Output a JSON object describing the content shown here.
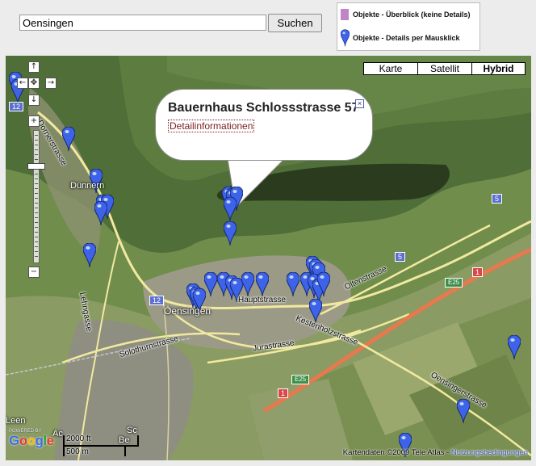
{
  "search": {
    "value": "Oensingen",
    "button_label": "Suchen"
  },
  "legend": {
    "overview_label": "Objekte - Überblick (keine Details)",
    "details_label": "Objekte - Details per Mausklick",
    "overview_color": "#c084c7",
    "details_color": "#3d63e8"
  },
  "map_controls": {
    "pan_up": "↑",
    "pan_left": "←",
    "pan_center": "✥",
    "pan_right": "→",
    "pan_down": "↓",
    "zoom_in": "+",
    "zoom_out": "−"
  },
  "map_types": [
    {
      "label": "Karte",
      "active": false
    },
    {
      "label": "Satellit",
      "active": false
    },
    {
      "label": "Hybrid",
      "active": true
    }
  ],
  "info_window": {
    "title": "Bauernhaus Schlossstrasse 57",
    "link": "Detailinformationen",
    "close": "×"
  },
  "street_labels": [
    "Hauptstrasse",
    "Kestenholzstrasse",
    "Jurastrasse",
    "Solothurnstrasse",
    "Oltenstrasse",
    "Oensingerstrasse",
    "Lehngasse",
    "Dornerstrasse"
  ],
  "place_labels": [
    "Oensingen",
    "Dünnern",
    "Leen",
    "Ac",
    "Sc",
    "Be"
  ],
  "road_shields": {
    "r12": "12",
    "r5": "5",
    "r1": "1",
    "e25": "E25"
  },
  "branding": {
    "powered_by": "POWERED BY",
    "logo_letters": [
      "G",
      "o",
      "o",
      "g",
      "l",
      "e"
    ]
  },
  "scale": {
    "imperial": "2000 ft",
    "metric": "500 m"
  },
  "copyright": {
    "text": "Kartendaten ©2009 Tele Atlas - ",
    "link": "Nutzungsbedingungen"
  }
}
